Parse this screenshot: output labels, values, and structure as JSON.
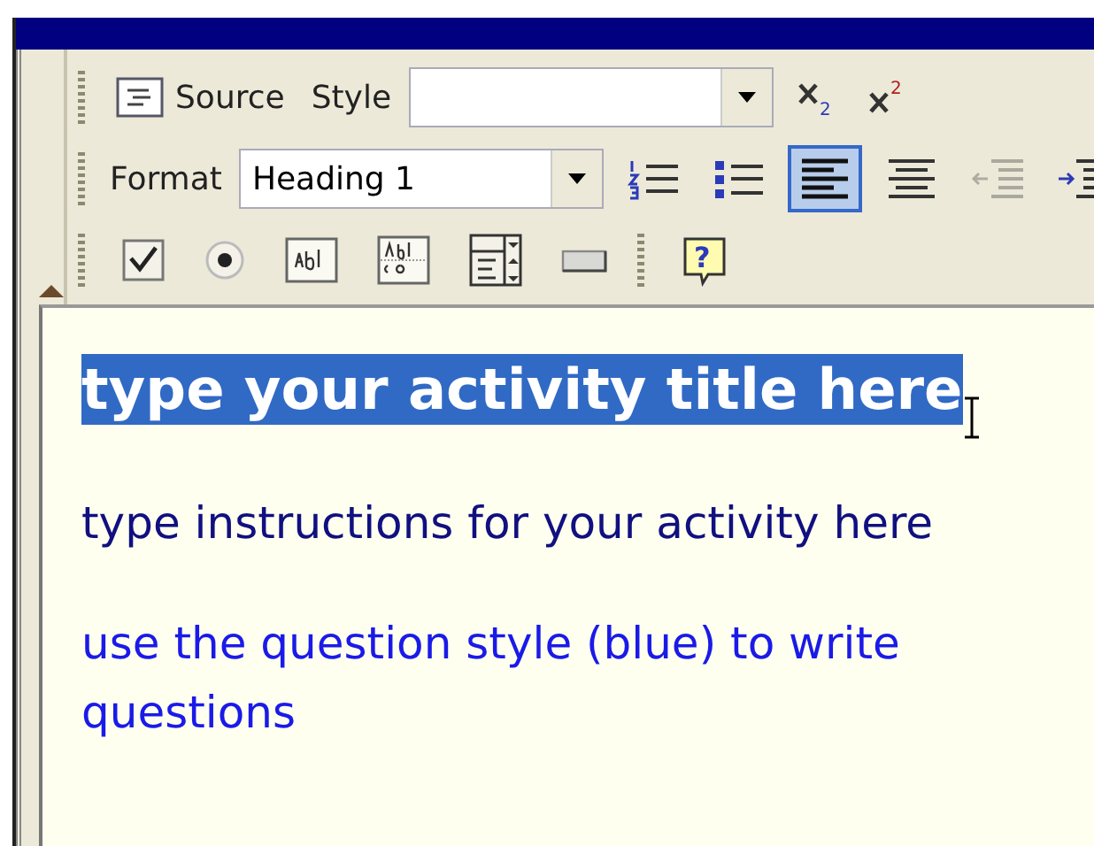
{
  "toolbar": {
    "rows": [
      {
        "items": [
          {
            "kind": "gripper"
          },
          {
            "kind": "source",
            "label": "Source",
            "selected": false,
            "disabled": false
          },
          {
            "kind": "label",
            "text": "Style"
          },
          {
            "kind": "combo"
          },
          {
            "kind": "subscript",
            "text": "2",
            "selected": false,
            "disabled": false
          },
          {
            "kind": "superscript",
            "text": "2",
            "selected": false,
            "disabled": false
          }
        ]
      },
      {
        "items": [
          {
            "kind": "gripper"
          },
          {
            "kind": "label",
            "text": "Format"
          },
          {
            "kind": "combo",
            "value": "Heading 1"
          },
          {
            "kind": "numbered",
            "selected": false,
            "disabled": false
          },
          {
            "kind": "bullets",
            "selected": false,
            "disabled": false
          },
          {
            "kind": "alignleft",
            "selected": true,
            "disabled": false
          },
          {
            "kind": "aligncenter",
            "selected": false,
            "disabled": false
          },
          {
            "kind": "outdent",
            "selected": false,
            "disabled": true
          },
          {
            "kind": "indent",
            "selected": false,
            "disabled": false
          }
        ]
      },
      {
        "items": [
          {
            "kind": "gripper"
          },
          {
            "kind": "checkbox",
            "selected": false,
            "disabled": false
          },
          {
            "kind": "radio",
            "selected": false,
            "disabled": false
          },
          {
            "kind": "textfield",
            "selected": false,
            "disabled": false
          },
          {
            "kind": "textarea",
            "selected": false,
            "disabled": false
          },
          {
            "kind": "select",
            "selected": false,
            "disabled": false
          },
          {
            "kind": "formbutton",
            "selected": false,
            "disabled": false
          },
          {
            "kind": "gripper"
          },
          {
            "kind": "help",
            "text": "?",
            "selected": false,
            "disabled": false
          }
        ]
      }
    ]
  },
  "editor": {
    "paragraphs": [
      {
        "kind": "heading",
        "text": "type your activity title here",
        "selected": true
      },
      {
        "kind": "instructions",
        "text": "type instructions for your activity here",
        "selected": false
      },
      {
        "kind": "question",
        "text": "use the question style (blue) to write questions",
        "selected": false
      }
    ]
  }
}
